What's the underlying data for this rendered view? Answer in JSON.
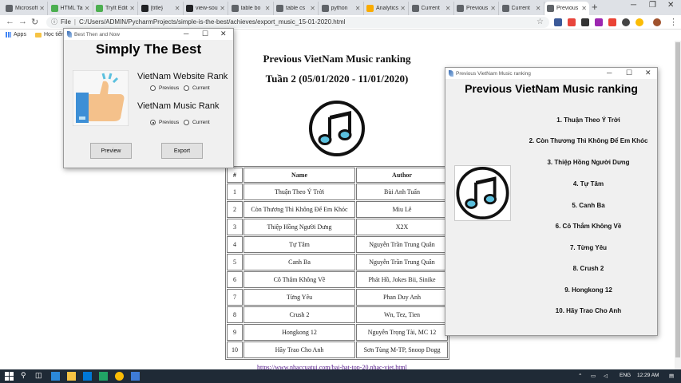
{
  "browser": {
    "tabs": [
      {
        "title": "Microsoft",
        "color": "#5f6368"
      },
      {
        "title": "HTML Tables",
        "color": "#4caf50"
      },
      {
        "title": "TryIt Editor",
        "color": "#4caf50"
      },
      {
        "title": "{title}",
        "color": "#202124"
      },
      {
        "title": "view-source",
        "color": "#202124"
      },
      {
        "title": "table bo",
        "color": "#5f6368"
      },
      {
        "title": "table cs",
        "color": "#5f6368"
      },
      {
        "title": "python",
        "color": "#5f6368"
      },
      {
        "title": "Analytics",
        "color": "#f9ab00"
      },
      {
        "title": "Current",
        "color": "#5f6368"
      },
      {
        "title": "Previous",
        "color": "#5f6368"
      },
      {
        "title": "Current",
        "color": "#5f6368"
      },
      {
        "title": "Previous",
        "color": "#5f6368"
      }
    ],
    "new_tab": "+",
    "url_info": "File",
    "url": "C:/Users/ADMIN/PycharmProjects/simple-is-the-best/achieves/export_music_15-01-2020.html",
    "bookmarks": [
      "Apps",
      "Học tiếng"
    ]
  },
  "page": {
    "title": "Previous VietNam Music ranking",
    "subtitle": "Tuần 2 (05/01/2020 - 11/01/2020)",
    "table": {
      "headers": [
        "#",
        "Name",
        "Author"
      ],
      "rows": [
        [
          "1",
          "Thuận Theo Ý Trời",
          "Bùi Anh Tuấn"
        ],
        [
          "2",
          "Còn Thương Thì Không Để Em Khóc",
          "Miu Lê"
        ],
        [
          "3",
          "Thiệp Hồng Người Dưng",
          "X2X"
        ],
        [
          "4",
          "Tự Tâm",
          "Nguyễn Trần Trung Quân"
        ],
        [
          "5",
          "Canh Ba",
          "Nguyễn Trần Trung Quân"
        ],
        [
          "6",
          "Cô Thắm Không Về",
          "Phát Hồ, Jokes Bii, Sinike"
        ],
        [
          "7",
          "Từng Yêu",
          "Phan Duy Anh"
        ],
        [
          "8",
          "Crush 2",
          "Wn, Tez, Tien"
        ],
        [
          "9",
          "Hongkong 12",
          "Nguyễn Trọng Tài, MC 12"
        ],
        [
          "10",
          "Hãy Trao Cho Anh",
          "Sơn Tùng M-TP, Snoop Dogg"
        ]
      ]
    },
    "link": "https://www.nhaccuatui.com/bai-hat-top-20.nhac-viet.html"
  },
  "best_window": {
    "titlebar": "Best Then and Now",
    "heading": "Simply The Best",
    "website_label": "VietNam Website Rank",
    "website_options": [
      "Previous",
      "Current"
    ],
    "website_selected": null,
    "music_label": "VietNam Music Rank",
    "music_options": [
      "Previous",
      "Current"
    ],
    "music_selected": "Previous",
    "preview_button": "Preview",
    "export_button": "Export"
  },
  "preview_window": {
    "titlebar": "Previous VietNam Music ranking",
    "heading": "Previous VietNam Music ranking",
    "items": [
      "1. Thuận Theo Ý Trời",
      "2. Còn Thương Thì Không Để Em Khóc",
      "3. Thiệp Hồng Người Dưng",
      "4. Tự Tâm",
      "5. Canh Ba",
      "6. Cô Thắm Không Về",
      "7. Từng Yêu",
      "8. Crush 2",
      "9. Hongkong 12",
      "10. Hãy Trao Cho Anh"
    ]
  },
  "taskbar": {
    "language": "ENG",
    "time": "12:29 AM"
  },
  "colors": {
    "music_icon_fill": "#5bc0de",
    "music_icon_stroke": "#111111",
    "thumb_fill": "#f4c18b",
    "sleeve": "#3d8fd6",
    "taskbar": "#1f2a36"
  }
}
